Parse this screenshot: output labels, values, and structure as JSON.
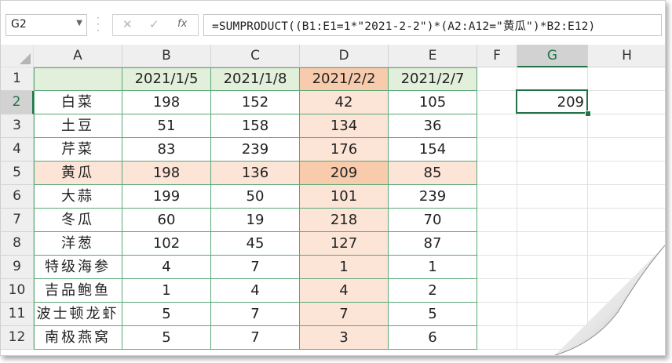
{
  "formula_bar": {
    "name_box": "G2",
    "cancel_glyph": "✕",
    "enter_glyph": "✓",
    "fx_glyph": "fx",
    "formula": "=SUMPRODUCT((B1:E1=1*\"2021-2-2\")*(A2:A12=\"黄瓜\")*B2:E12)"
  },
  "columns": [
    "A",
    "B",
    "C",
    "D",
    "E",
    "F",
    "G",
    "H"
  ],
  "selected_column": "G",
  "selected_row": "2",
  "rows": [
    {
      "n": "1",
      "a": "",
      "b": "2021/1/5",
      "c": "2021/1/8",
      "d": "2021/2/2",
      "e": "2021/2/7"
    },
    {
      "n": "2",
      "a": "白菜",
      "b": "198",
      "c": "152",
      "d": "42",
      "e": "105"
    },
    {
      "n": "3",
      "a": "土豆",
      "b": "51",
      "c": "158",
      "d": "134",
      "e": "36"
    },
    {
      "n": "4",
      "a": "芹菜",
      "b": "83",
      "c": "239",
      "d": "176",
      "e": "154"
    },
    {
      "n": "5",
      "a": "黄瓜",
      "b": "198",
      "c": "136",
      "d": "209",
      "e": "85"
    },
    {
      "n": "6",
      "a": "大蒜",
      "b": "199",
      "c": "50",
      "d": "101",
      "e": "239"
    },
    {
      "n": "7",
      "a": "冬瓜",
      "b": "60",
      "c": "19",
      "d": "218",
      "e": "70"
    },
    {
      "n": "8",
      "a": "洋葱",
      "b": "102",
      "c": "45",
      "d": "127",
      "e": "87"
    },
    {
      "n": "9",
      "a": "特级海参",
      "b": "4",
      "c": "7",
      "d": "1",
      "e": "1"
    },
    {
      "n": "10",
      "a": "吉品鲍鱼",
      "b": "1",
      "c": "4",
      "d": "4",
      "e": "2"
    },
    {
      "n": "11",
      "a": "波士顿龙虾",
      "b": "5",
      "c": "7",
      "d": "7",
      "e": "5"
    },
    {
      "n": "12",
      "a": "南极燕窝",
      "b": "5",
      "c": "7",
      "d": "3",
      "e": "6"
    }
  ],
  "result_cell": {
    "ref": "G2",
    "value": "209"
  },
  "colors": {
    "accent_green": "#217346",
    "table_border": "#5aa878",
    "highlight_light": "#fce4d6",
    "highlight_dark": "#f8cbad",
    "header_fill": "#e2efda"
  }
}
